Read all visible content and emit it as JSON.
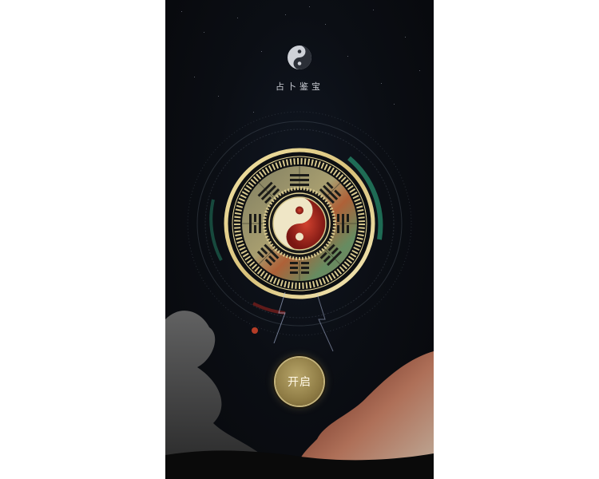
{
  "app": {
    "title": "占卜鉴宝",
    "logo_icon": "yin-yang-icon"
  },
  "center": {
    "graphic_icon": "bagua-compass-icon"
  },
  "actions": {
    "start_label": "开启"
  },
  "colors": {
    "background": "#0b0e14",
    "gold": "#c6b57c",
    "aura_green": "#2fb889",
    "aura_red": "#b3261e"
  }
}
